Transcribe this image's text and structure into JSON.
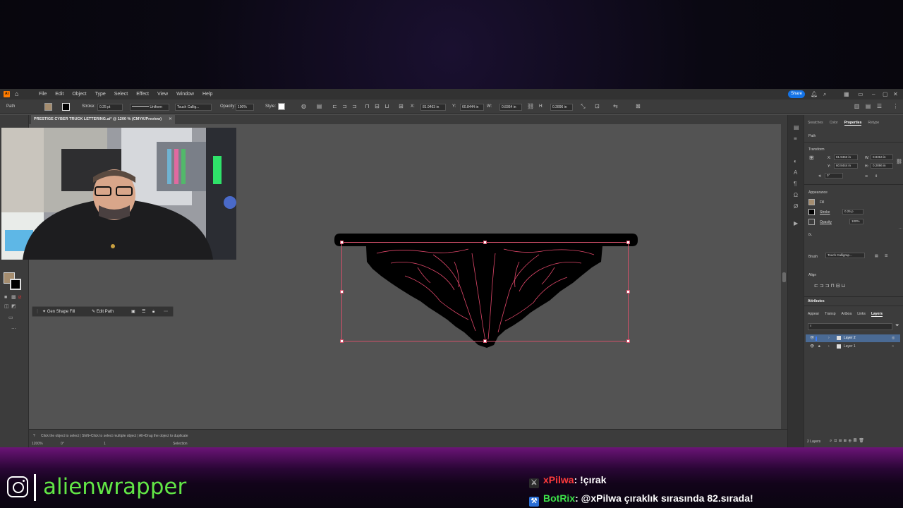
{
  "menubar": {
    "items": [
      "File",
      "Edit",
      "Object",
      "Type",
      "Select",
      "Effect",
      "View",
      "Window",
      "Help"
    ],
    "share_label": "Share"
  },
  "controlbar": {
    "selection_type": "Path",
    "stroke_label": "Stroke:",
    "stroke_value": "0.25 pt",
    "stroke_profile": "Uniform",
    "brush": "Touch Callig...",
    "opacity_label": "Opacity:",
    "opacity_value": "100%",
    "style_label": "Style:",
    "x_label": "X:",
    "x_value": "81.9463 in",
    "y_label": "Y:",
    "y_value": "60.8444 in",
    "w_label": "W:",
    "w_value": "0.8364 in",
    "h_label": "H:",
    "h_value": "0.2896 in",
    "fill_color": "#a58d6f",
    "stroke_color": "#000000"
  },
  "document": {
    "tab_title": "PRESTIGE CYBER TRUCK LETTERING.ai* @ 1200 % (CMYK/Preview)"
  },
  "contextual_bar": {
    "gen_shape_fill": "Gen Shape Fill",
    "edit_path": "Edit Path"
  },
  "statusbar": {
    "hint": "Click the object to select  |  Shift+Click to select multiple object  |  Alt+Drag the object to duplicate",
    "zoom": "1200%",
    "rotation": "0°",
    "artboard": "1",
    "tool": "Selection"
  },
  "properties_panel": {
    "tabs": [
      "Swatches",
      "Color",
      "Properties",
      "Retype"
    ],
    "active_tab": "Properties",
    "selection": "Path",
    "transform_label": "Transform",
    "x": "81.9463 in",
    "y": "60.8444 in",
    "w": "0.8364 in",
    "h": "0.2896 in",
    "angle": "0°",
    "appearance_label": "Appearance",
    "fill_label": "Fill",
    "stroke_label": "Stroke",
    "stroke_value": "0.25 p",
    "opacity_label": "Opacity",
    "opacity_value": "100%",
    "fx_label": "fx.",
    "brush_label": "Brush",
    "brush_value": "Touch Calligrap...",
    "align_label": "Align"
  },
  "attributes_panel": {
    "title": "Attributes"
  },
  "layers_panel": {
    "tabs": [
      "Appear",
      "Transp",
      "Artboa",
      "Links",
      "Layers"
    ],
    "active_tab": "Layers",
    "layers": [
      {
        "name": "Layer 2",
        "selected": true
      },
      {
        "name": "Layer 1",
        "selected": false
      }
    ],
    "footer_count": "2 Layers"
  },
  "overlay": {
    "instagram_handle": "alienwrapper",
    "chat": [
      {
        "user": "xPilwa",
        "message": ": !çırak"
      },
      {
        "user": "BotRix",
        "message": ": @xPilwa çıraklık sırasında 82.sırada!"
      }
    ]
  },
  "colors": {
    "selection_outline": "#d4506a",
    "artwork_fill": "#000000",
    "artwork_inner_lines": "#e0476a",
    "handle_text": "#62e646",
    "accent_blue": "#1473e6"
  }
}
